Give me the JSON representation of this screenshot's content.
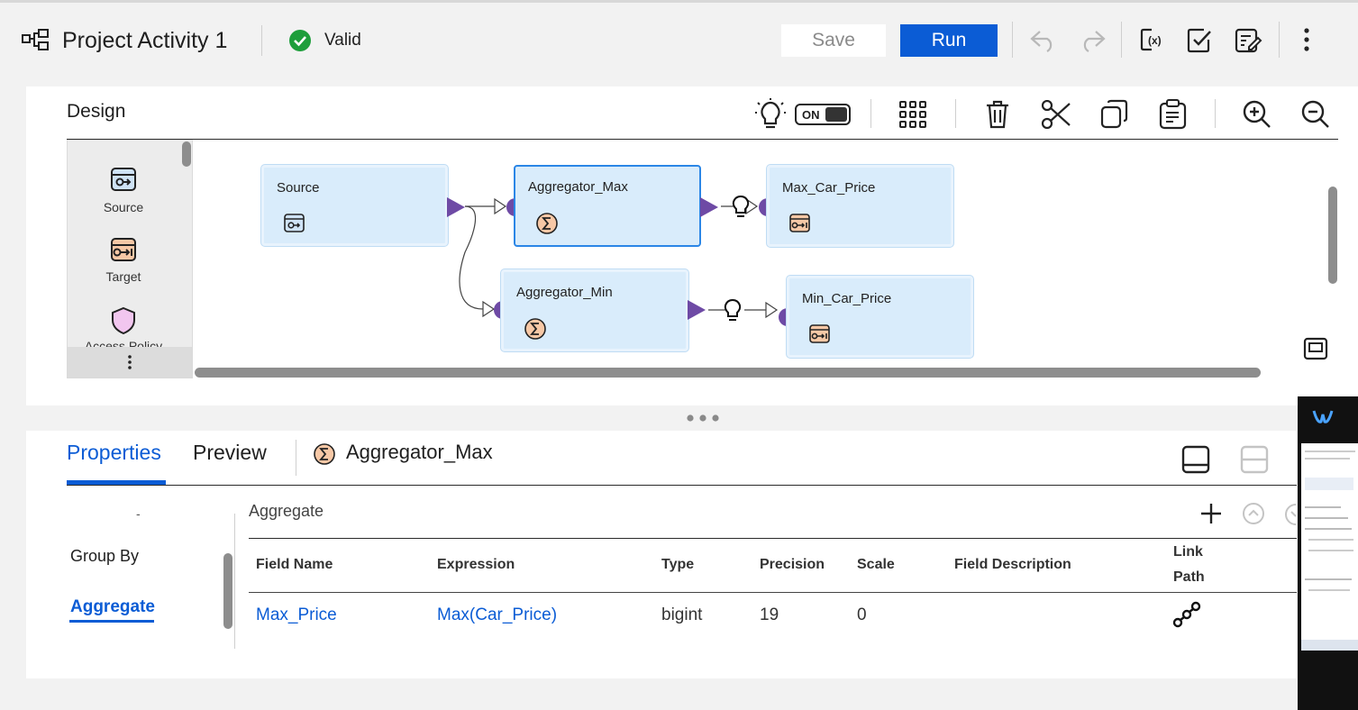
{
  "header": {
    "title": "Project Activity 1",
    "status": "Valid",
    "save_label": "Save",
    "run_label": "Run"
  },
  "design": {
    "label": "Design",
    "toggle_label": "ON"
  },
  "palette": {
    "items": [
      "Source",
      "Target",
      "Access Policy"
    ]
  },
  "nodes": {
    "source": "Source",
    "agg_max": "Aggregator_Max",
    "agg_min": "Aggregator_Min",
    "max_target": "Max_Car_Price",
    "min_target": "Min_Car_Price"
  },
  "bottom": {
    "tabs": [
      "Properties",
      "Preview"
    ],
    "selected_object": "Aggregator_Max",
    "sidebar": [
      "Group By",
      "Aggregate"
    ],
    "section_title": "Aggregate",
    "columns": [
      "Field Name",
      "Expression",
      "Type",
      "Precision",
      "Scale",
      "Field Description",
      "Link",
      "Path"
    ],
    "rows": [
      {
        "field_name": "Max_Price",
        "expression": "Max(Car_Price)",
        "type": "bigint",
        "precision": "19",
        "scale": "0",
        "description": ""
      }
    ]
  },
  "colors": {
    "accent": "#0b5cd5",
    "valid": "#1e9e3b",
    "port": "#6e4aa5",
    "node_fill": "#d9ecfb"
  },
  "icons": [
    "mapping-icon",
    "check-circle-icon",
    "undo-icon",
    "redo-icon",
    "parameter-icon",
    "validate-icon",
    "edit-properties-icon",
    "more-vert-icon",
    "recommendation-bulb-icon",
    "grid-icon",
    "delete-icon",
    "cut-icon",
    "copy-icon",
    "paste-icon",
    "zoom-in-icon",
    "zoom-out-icon"
  ]
}
